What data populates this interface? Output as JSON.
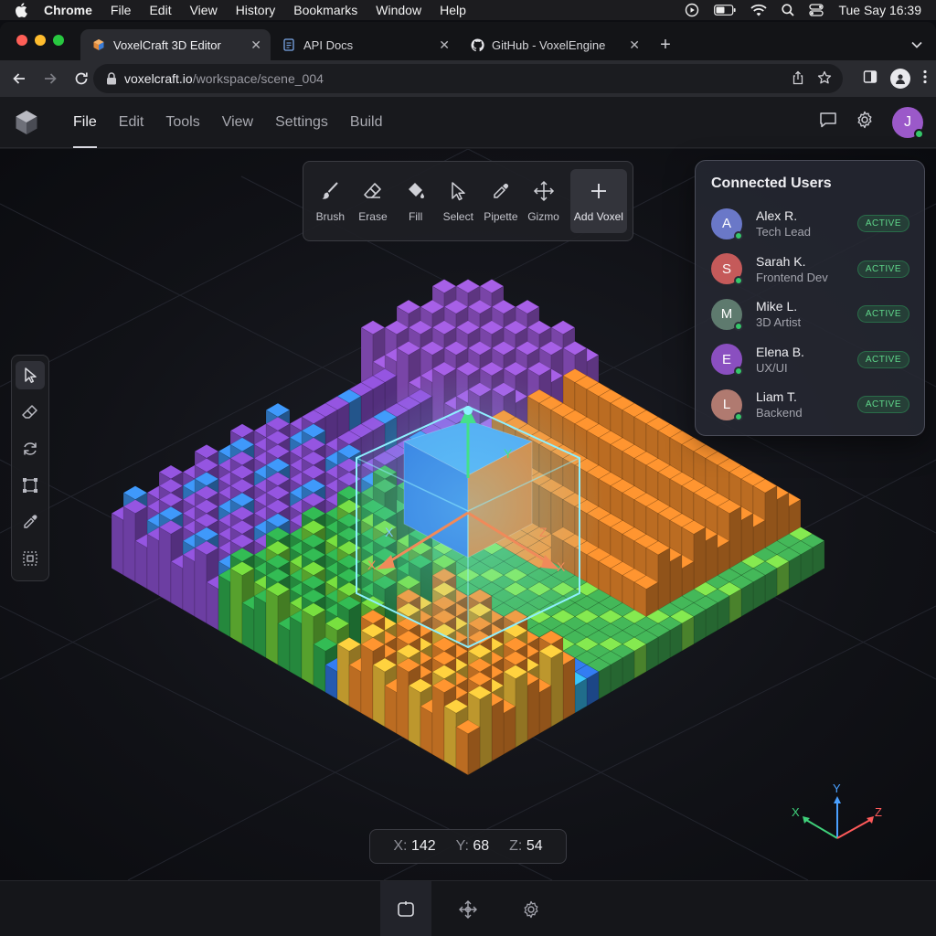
{
  "menubar": {
    "app": "Chrome",
    "items": [
      "File",
      "Edit",
      "View",
      "History",
      "Bookmarks",
      "Window",
      "Help"
    ],
    "clock": "Tue Say 16:39"
  },
  "tabs": [
    {
      "title": "VoxelCraft 3D Editor",
      "icon": "cube-icon",
      "active": true
    },
    {
      "title": "API Docs",
      "icon": "document-icon",
      "active": false
    },
    {
      "title": "GitHub - VoxelEngine",
      "icon": "github-icon",
      "active": false
    }
  ],
  "address": {
    "host": "voxelcraft.io",
    "path": "/workspace/scene_004"
  },
  "app": {
    "menu": [
      "File",
      "Edit",
      "Tools",
      "View",
      "Settings",
      "Build"
    ],
    "user_initial": "J",
    "accent": "#9b59c9"
  },
  "tools": [
    {
      "label": "Brush",
      "icon": "brush-icon"
    },
    {
      "label": "Erase",
      "icon": "eraser-icon"
    },
    {
      "label": "Fill",
      "icon": "fill-bucket-icon"
    },
    {
      "label": "Select",
      "icon": "cursor-icon"
    },
    {
      "label": "Pipette",
      "icon": "pipette-icon"
    },
    {
      "label": "Gizmo",
      "icon": "move-icon"
    },
    {
      "label": "Add Voxel",
      "icon": "plus-icon"
    }
  ],
  "gizmo_labels": {
    "x": "X",
    "y": "Y",
    "z": "Z"
  },
  "users_panel": {
    "title": "Connected Users",
    "users": [
      {
        "initial": "A",
        "name": "Alex R.",
        "role": "Tech Lead",
        "status": "ACTIVE",
        "color": "#6a78c8"
      },
      {
        "initial": "S",
        "name": "Sarah K.",
        "role": "Frontend Dev",
        "status": "ACTIVE",
        "color": "#c55a5a"
      },
      {
        "initial": "M",
        "name": "Mike L.",
        "role": "3D Artist",
        "status": "ACTIVE",
        "color": "#5e7a6e"
      },
      {
        "initial": "E",
        "name": "Elena B.",
        "role": "UX/UI",
        "status": "ACTIVE",
        "color": "#8a4fc0"
      },
      {
        "initial": "L",
        "name": "Liam T.",
        "role": "Backend",
        "status": "ACTIVE",
        "color": "#b07a70"
      }
    ]
  },
  "coords": {
    "x_label": "X:",
    "x": "142",
    "y_label": "Y:",
    "y": "68",
    "z_label": "Z:",
    "z": "54"
  }
}
